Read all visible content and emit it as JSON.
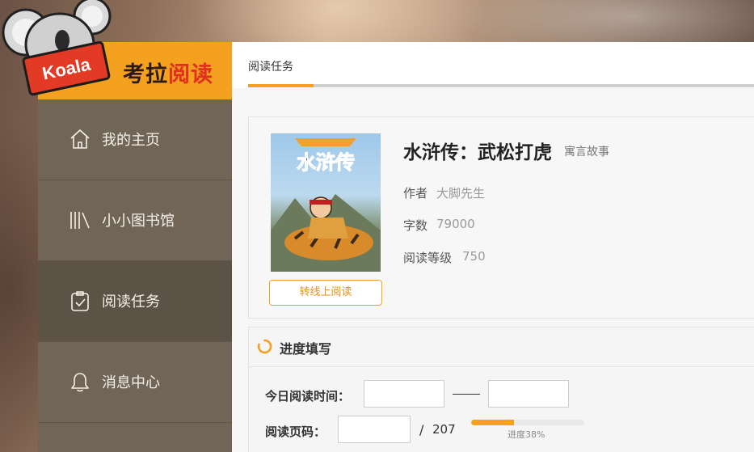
{
  "brand": {
    "logo_text": "Koala",
    "name_part1": "考拉",
    "name_part2": "阅读"
  },
  "sidebar": {
    "items": [
      {
        "label": "我的主页",
        "icon": "home-icon",
        "active": false
      },
      {
        "label": "小小图书馆",
        "icon": "library-icon",
        "active": false
      },
      {
        "label": "阅读任务",
        "icon": "clipboard-check-icon",
        "active": true
      },
      {
        "label": "消息中心",
        "icon": "bell-icon",
        "active": false
      }
    ]
  },
  "main": {
    "tabs": [
      {
        "label": "阅读任务",
        "active": true
      }
    ],
    "book": {
      "title": "水浒传：武松打虎",
      "category": "寓言故事",
      "cover_title": "水浒传",
      "author_label": "作者",
      "author": "大脚先生",
      "words_label": "字数",
      "words": "79000",
      "level_label": "阅读等级",
      "level": "750",
      "read_online_button": "转线上阅读"
    },
    "progress_section": {
      "title": "进度填写",
      "time_label": "今日阅读时间：",
      "time_start_value": "",
      "time_end_value": "",
      "pages_label": "阅读页码：",
      "pages_value": "",
      "slash": "/",
      "total_pages": "207",
      "progress_fraction": 0.38,
      "progress_text": "进度38%"
    }
  },
  "colors": {
    "accent": "#f4a11f",
    "sidebar_bg": "#706556",
    "sidebar_active_bg": "#5d5246",
    "brand_red": "#e0301e"
  }
}
